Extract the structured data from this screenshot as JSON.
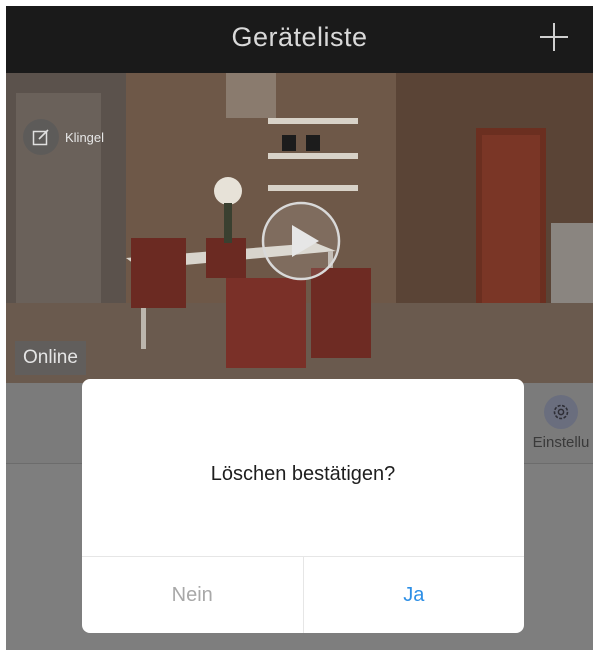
{
  "header": {
    "title": "Geräteliste",
    "add_icon": "plus-icon"
  },
  "device": {
    "name": "Klingel",
    "edit_icon": "edit-icon",
    "play_icon": "play-icon",
    "status": "Online"
  },
  "toolbar": {
    "settings_label": "Einstellu",
    "settings_icon": "gear-icon"
  },
  "dialog": {
    "message": "Löschen bestätigen?",
    "cancel_label": "Nein",
    "confirm_label": "Ja"
  },
  "colors": {
    "header_bg": "#1a1a1a",
    "confirm": "#2d8fe6",
    "cancel": "#a8a8a8"
  }
}
